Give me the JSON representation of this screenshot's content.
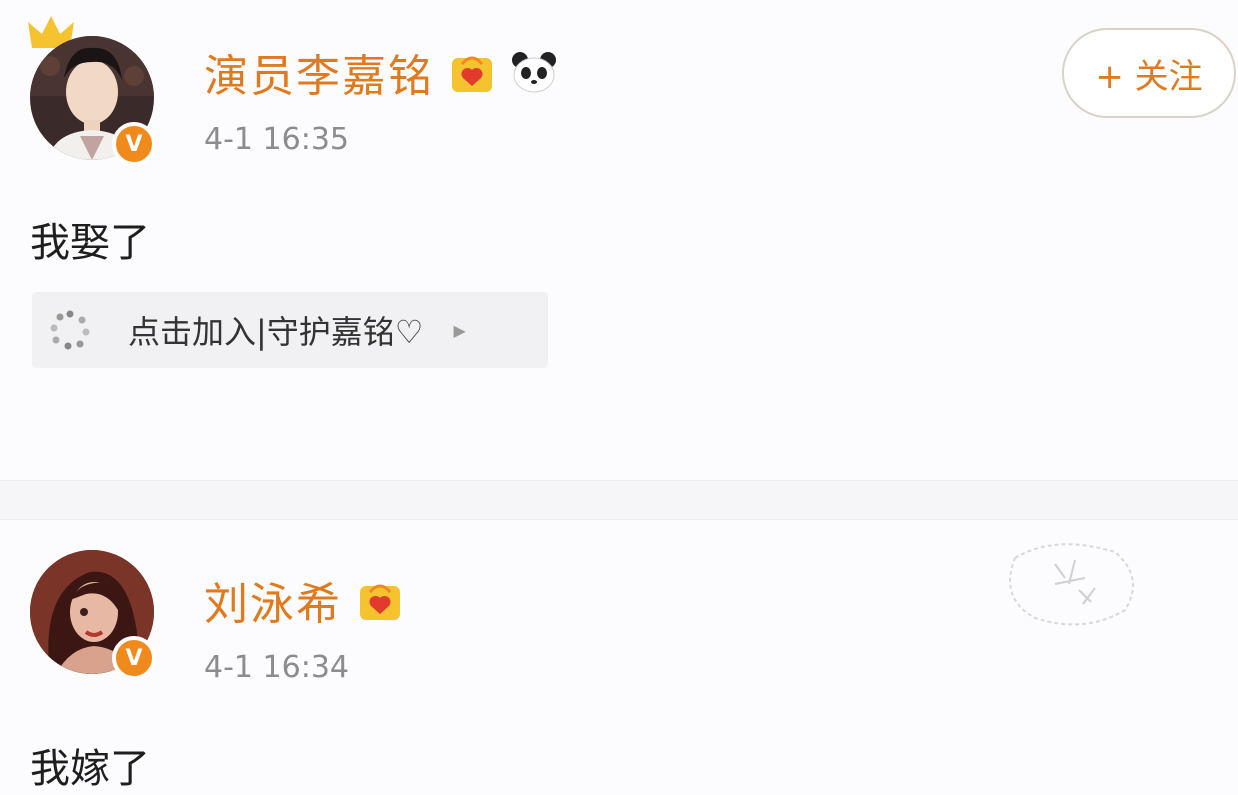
{
  "posts": [
    {
      "username": "演员李嘉铭",
      "timestamp": "4-1 16:35",
      "text": "我娶了",
      "fan_club": {
        "label": "点击加入|守护嘉铭♡"
      },
      "follow_label": "+ 关注"
    },
    {
      "username": "刘泳希",
      "timestamp": "4-1 16:34",
      "text": "我嫁了"
    }
  ],
  "badge_text": "V",
  "colors": {
    "username": "#e07a1f",
    "timestamp": "#8c8c90",
    "badge": "#f08a1c",
    "crown": "#f5c230"
  },
  "icons": {
    "crown": "crown-icon",
    "verified": "verified-badge-icon",
    "gift": "gift-badge-icon",
    "panda": "panda-icon",
    "fan_club": "sparkle-dots-icon",
    "arrow": "triangle-right-icon"
  }
}
